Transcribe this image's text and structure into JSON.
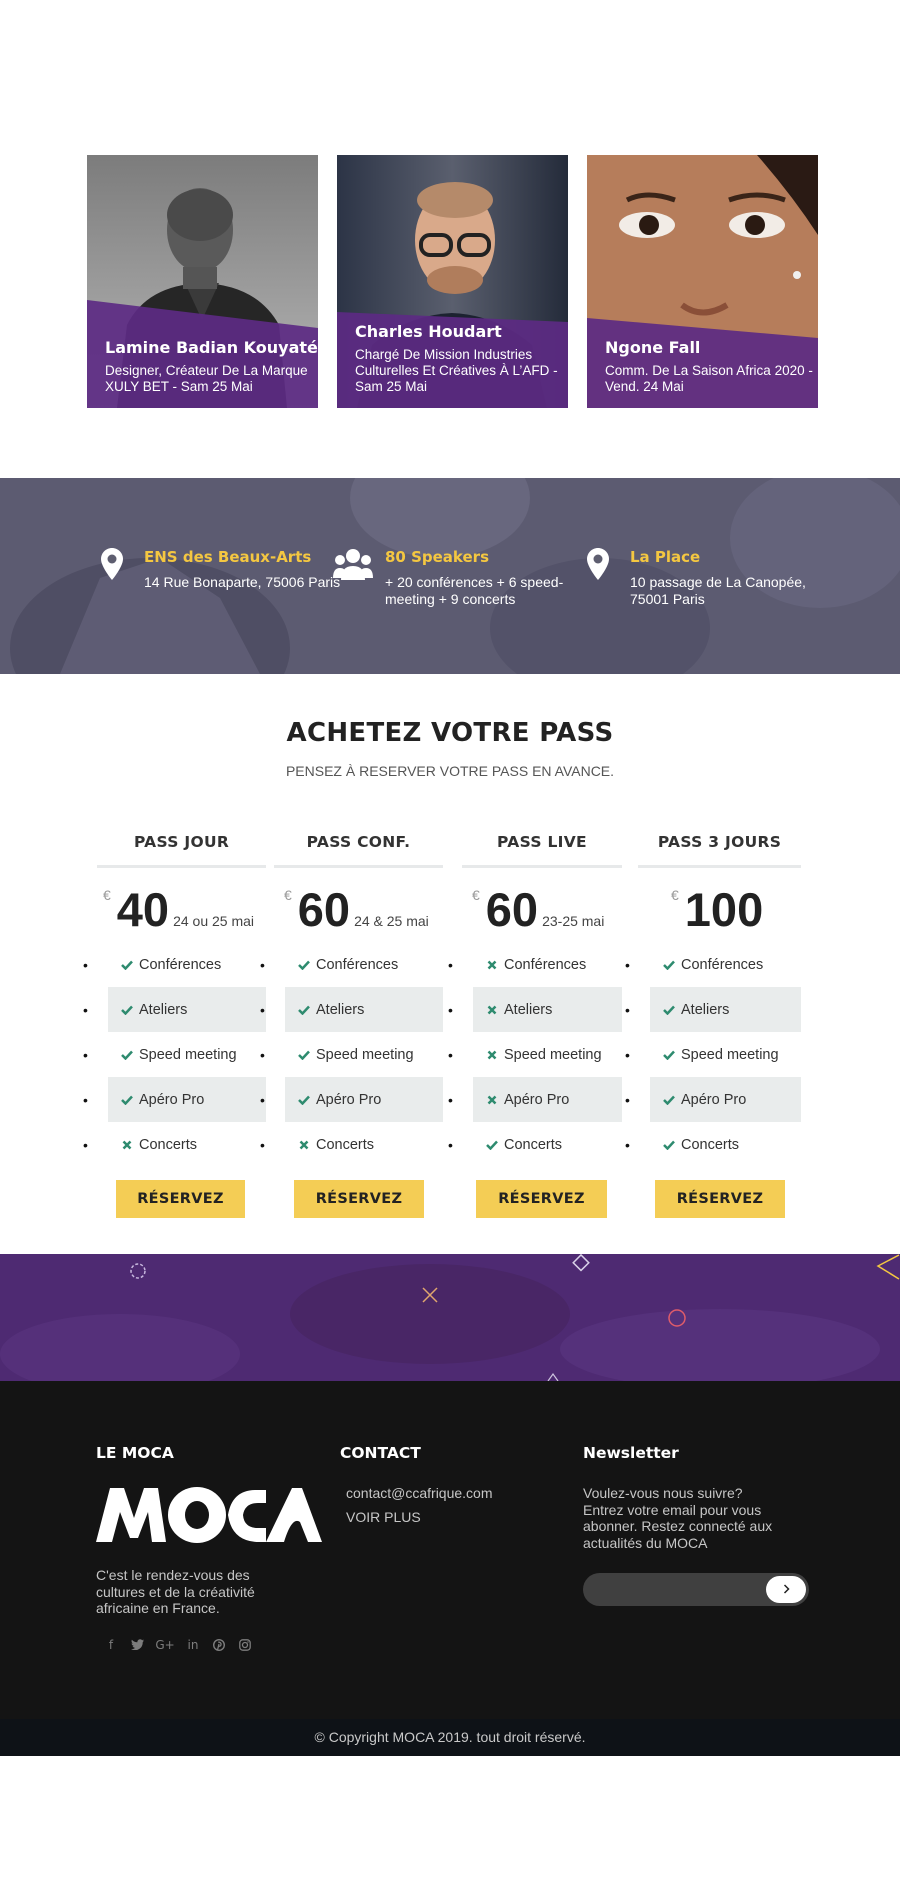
{
  "speakers": [
    {
      "name": "Lamine Badian Kouyaté",
      "role": "Designer, Créateur De La Marque XULY BET - Sam 25 Mai"
    },
    {
      "name": "Charles Houdart",
      "role": "Chargé De Mission Industries Culturelles Et Créatives À L’AFD - Sam 25 Mai"
    },
    {
      "name": "Ngone Fall",
      "role": "Comm. De La Saison Africa 2020 - Vend. 24 Mai"
    }
  ],
  "info": [
    {
      "icon": "map-pin-icon",
      "title": "ENS des Beaux-Arts",
      "desc": "14 Rue Bonaparte, 75006 Paris"
    },
    {
      "icon": "users-icon",
      "title": "80 Speakers",
      "desc": "+ 20 conférences + 6 speed-meeting + 9 concerts"
    },
    {
      "icon": "map-pin-icon",
      "title": "La Place",
      "desc": "10 passage de La Canopée, 75001 Paris"
    }
  ],
  "pricing": {
    "title": "ACHETEZ VOTRE PASS",
    "subtitle": "PENSEZ À RESERVER VOTRE PASS EN AVANCE.",
    "currency": "€",
    "plans": [
      {
        "name": "PASS JOUR",
        "price": "40",
        "dates": "24 ou 25 mai",
        "button": "RÉSERVEZ",
        "features": [
          {
            "label": "Conférences",
            "included": true
          },
          {
            "label": "Ateliers",
            "included": true
          },
          {
            "label": "Speed meeting",
            "included": true
          },
          {
            "label": "Apéro Pro",
            "included": true
          },
          {
            "label": "Concerts",
            "included": false
          }
        ]
      },
      {
        "name": "PASS CONF.",
        "price": "60",
        "dates": "24 & 25 mai",
        "button": "RÉSERVEZ",
        "features": [
          {
            "label": "Conférences",
            "included": true
          },
          {
            "label": "Ateliers",
            "included": true
          },
          {
            "label": "Speed meeting",
            "included": true
          },
          {
            "label": "Apéro Pro",
            "included": true
          },
          {
            "label": "Concerts",
            "included": false
          }
        ]
      },
      {
        "name": "PASS LIVE",
        "price": "60",
        "dates": "23-25 mai",
        "button": "RÉSERVEZ",
        "features": [
          {
            "label": "Conférences",
            "included": false
          },
          {
            "label": "Ateliers",
            "included": false
          },
          {
            "label": "Speed meeting",
            "included": false
          },
          {
            "label": "Apéro Pro",
            "included": false
          },
          {
            "label": "Concerts",
            "included": true
          }
        ]
      },
      {
        "name": "PASS 3 JOURS",
        "price": "100",
        "dates": "",
        "button": "RÉSERVEZ",
        "features": [
          {
            "label": "Conférences",
            "included": true
          },
          {
            "label": "Ateliers",
            "included": true
          },
          {
            "label": "Speed meeting",
            "included": true
          },
          {
            "label": "Apéro Pro",
            "included": true
          },
          {
            "label": "Concerts",
            "included": true
          }
        ]
      }
    ]
  },
  "footer": {
    "about": {
      "heading": "LE MOCA",
      "logo_text": "MOCA",
      "description": "C'est le rendez-vous des cultures et de la créativité africaine en France.",
      "socials": [
        "facebook-icon",
        "twitter-icon",
        "google-plus-icon",
        "linkedin-icon",
        "pinterest-icon",
        "instagram-icon"
      ]
    },
    "contact": {
      "heading": "CONTACT",
      "email": "contact@ccafrique.com",
      "more": "VOIR PLUS"
    },
    "newsletter": {
      "heading": "Newsletter",
      "text": "Voulez-vous nous suivre? Entrez votre email pour vous abonner. Restez connecté aux actualités du MOCA",
      "placeholder": ""
    }
  },
  "copyright": "© Copyright MOCA 2019. tout droit réservé.",
  "colors": {
    "accent_yellow": "#f4c741",
    "button_yellow": "#f4cd55",
    "purple": "#5a2d82",
    "check_green": "#2e8b6f",
    "footer_bg": "#141414"
  }
}
